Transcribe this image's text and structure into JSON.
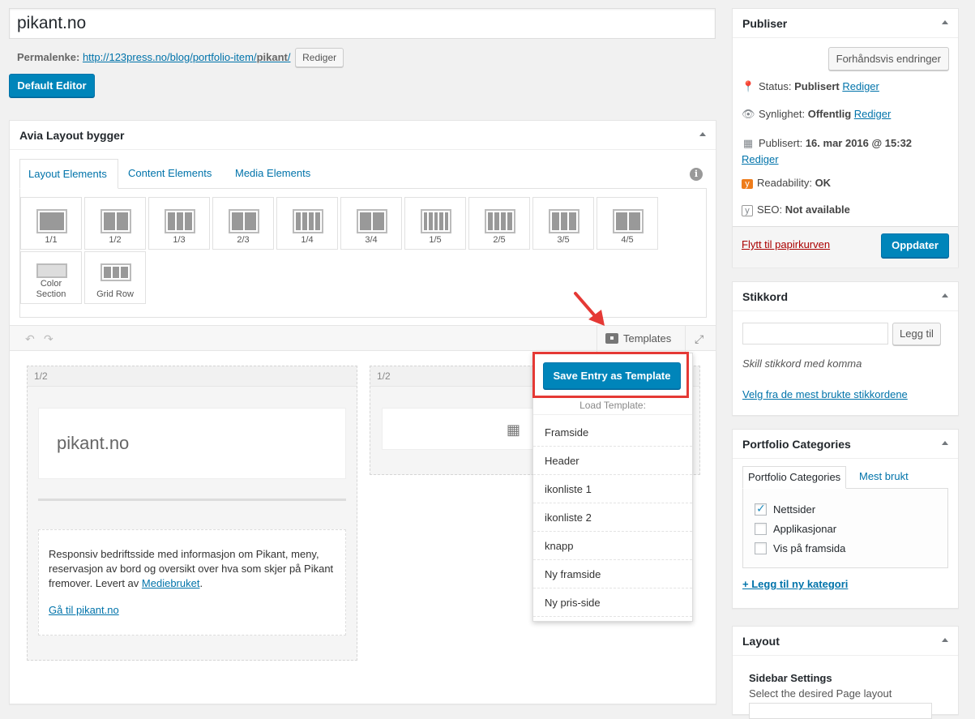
{
  "post": {
    "title": "pikant.no",
    "permalink_label": "Permalenke:",
    "permalink_base": "http://123press.no/blog/portfolio-item/",
    "permalink_slug": "pikant",
    "permalink_trail": "/",
    "edit_label": "Rediger",
    "default_editor_label": "Default Editor"
  },
  "avia": {
    "title": "Avia Layout bygger",
    "tabs": [
      "Layout Elements",
      "Content Elements",
      "Media Elements"
    ],
    "elements": [
      {
        "label": "1/1",
        "cols": 1
      },
      {
        "label": "1/2",
        "cols": 2
      },
      {
        "label": "1/3",
        "cols": 3
      },
      {
        "label": "2/3",
        "cols": 2
      },
      {
        "label": "1/4",
        "cols": 4
      },
      {
        "label": "3/4",
        "cols": 2
      },
      {
        "label": "1/5",
        "cols": 5
      },
      {
        "label": "2/5",
        "cols": 4
      },
      {
        "label": "3/5",
        "cols": 3
      },
      {
        "label": "4/5",
        "cols": 2
      }
    ],
    "color_section_label_1": "Color",
    "color_section_label_2": "Section",
    "grid_row_label": "Grid Row",
    "templates_label": "Templates",
    "canvas": {
      "col1_label": "1/2",
      "col2_label": "1/2",
      "heading_text": "pikant.no",
      "body_text": "Responsiv bedriftsside med informasjon om Pikant, meny, reservasjon av bord og oversikt over hva som skjer på Pikant fremover. Levert av",
      "body_link": "Mediebruket",
      "body_period": ".",
      "cta_link": "Gå til pikant.no"
    },
    "dropdown": {
      "save_label": "Save Entry as Template",
      "load_label": "Load Template:",
      "items": [
        "Framside",
        "Header",
        "ikonliste 1",
        "ikonliste 2",
        "knapp",
        "Ny framside",
        "Ny pris-side"
      ]
    }
  },
  "publish": {
    "title": "Publiser",
    "preview_label": "Forhåndsvis endringer",
    "status_label": "Status:",
    "status_value": "Publisert",
    "visibility_label": "Synlighet:",
    "visibility_value": "Offentlig",
    "published_label": "Publisert:",
    "published_value": "16. mar 2016 @ 15:32",
    "edit_label": "Rediger",
    "readability_label": "Readability:",
    "readability_value": "OK",
    "seo_label": "SEO:",
    "seo_value": "Not available",
    "trash_label": "Flytt til papirkurven",
    "update_label": "Oppdater"
  },
  "tags": {
    "title": "Stikkord",
    "add_label": "Legg til",
    "hint": "Skill stikkord med komma",
    "most_used_link": "Velg fra de mest brukte stikkordene"
  },
  "portfolio": {
    "title": "Portfolio Categories",
    "tab_all": "Portfolio Categories",
    "tab_popular": "Mest brukt",
    "categories": [
      {
        "label": "Nettsider",
        "checked": true
      },
      {
        "label": "Applikasjonar",
        "checked": false
      },
      {
        "label": "Vis på framsida",
        "checked": false
      }
    ],
    "add_new": "+ Legg til ny kategori"
  },
  "layout": {
    "title": "Layout",
    "sidebar_settings": "Sidebar Settings",
    "sidebar_hint": "Select the desired Page layout"
  },
  "colors": {
    "wp_blue": "#0085ba",
    "link": "#0073aa",
    "highlight_red": "#e53935"
  }
}
